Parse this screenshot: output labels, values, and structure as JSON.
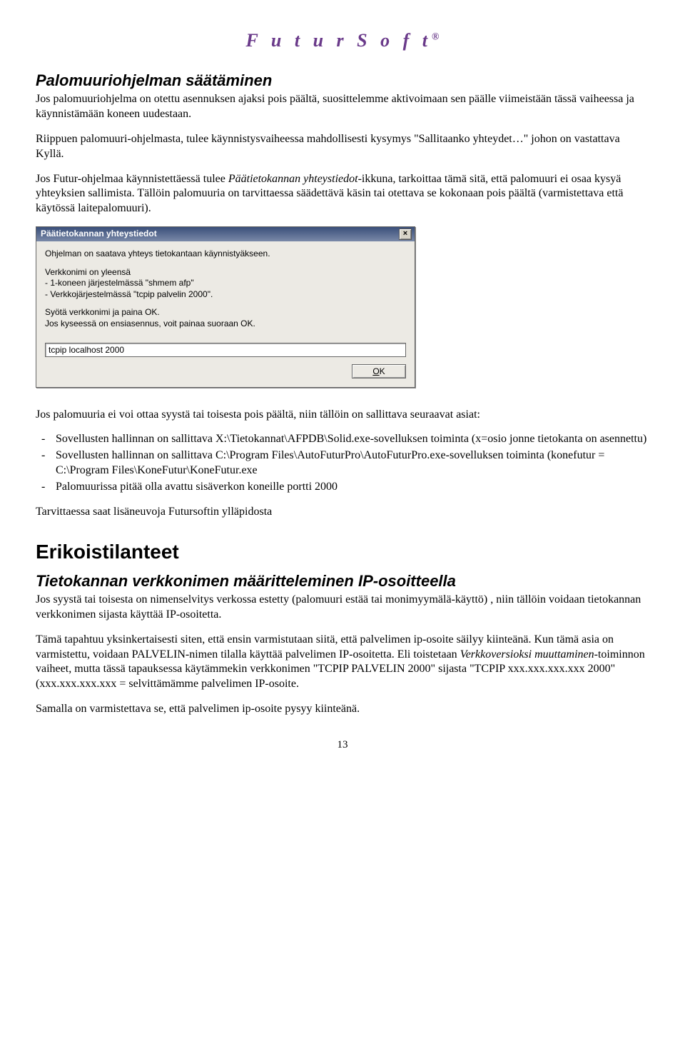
{
  "logo": "F u t u r S o f t",
  "logo_mark": "®",
  "section1": {
    "title": "Palomuuriohjelman säätäminen",
    "p1": "Jos palomuuriohjelma on otettu asennuksen ajaksi pois päältä, suosittelemme aktivoimaan sen päälle viimeistään tässä vaiheessa ja käynnistämään koneen uudestaan.",
    "p2": "Riippuen palomuuri-ohjelmasta, tulee käynnistysvaiheessa mahdollisesti kysymys \"Sallitaanko yhteydet…\" johon on vastattava Kyllä.",
    "p3a": "Jos Futur-ohjelmaa käynnistettäessä tulee ",
    "p3b": "Päätietokannan yhteystiedot",
    "p3c": "-ikkuna, tarkoittaa tämä sitä, että palomuuri ei osaa kysyä yhteyksien sallimista. Tällöin palomuuria on tarvittaessa säädettävä käsin tai otettava se kokonaan pois päältä (varmistettava että käytössä laitepalomuuri)."
  },
  "dialog": {
    "title": "Päätietokannan yhteystiedot",
    "line1": "Ohjelman on saatava yhteys tietokantaan käynnistyäkseen.",
    "line2": "Verkkonimi on yleensä",
    "line3": "- 1-koneen järjestelmässä \"shmem afp\"",
    "line4": "- Verkkojärjestelmässä \"tcpip palvelin 2000\".",
    "line5": "Syötä verkkonimi ja paina OK.",
    "line6": "Jos kyseessä on ensiasennus, voit painaa suoraan OK.",
    "input_value": "tcpip localhost 2000",
    "ok_label": "OK"
  },
  "section2": {
    "p1": "Jos palomuuria ei voi ottaa syystä tai toisesta pois päältä, niin tällöin on sallittava seuraavat asiat:",
    "bullets": [
      "Sovellusten hallinnan on sallittava X:\\Tietokannat\\AFPDB\\Solid.exe-sovelluksen toiminta (x=osio jonne tietokanta on asennettu)",
      "Sovellusten hallinnan on sallittava C:\\Program Files\\AutoFuturPro\\AutoFuturPro.exe-sovelluksen toiminta (konefutur = C:\\Program Files\\KoneFutur\\KoneFutur.exe",
      "Palomuurissa pitää olla avattu sisäverkon koneille portti 2000"
    ],
    "p2": "Tarvittaessa saat lisäneuvoja Futursoftin ylläpidosta"
  },
  "section3": {
    "title": "Erikoistilanteet",
    "subtitle": "Tietokannan verkkonimen määritteleminen IP-osoitteella",
    "p1": "Jos syystä tai toisesta on nimenselvitys verkossa estetty (palomuuri estää tai monimyymälä-käyttö) , niin tällöin voidaan tietokannan verkkonimen sijasta käyttää IP-osoitetta.",
    "p2a": "Tämä tapahtuu yksinkertaisesti siten, että ensin varmistutaan siitä, että palvelimen ip-osoite säilyy kiinteänä. Kun tämä asia on varmistettu, voidaan PALVELIN-nimen tilalla käyttää palvelimen IP-osoitetta. Eli toistetaan ",
    "p2b": "Verkkoversioksi muuttaminen",
    "p2c": "-toiminnon vaiheet, mutta tässä tapauksessa käytämmekin verkkonimen \"TCPIP PALVELIN 2000\" sijasta \"TCPIP xxx.xxx.xxx.xxx 2000\" (xxx.xxx.xxx.xxx = selvittämämme palvelimen IP-osoite.",
    "p3": "Samalla on varmistettava se, että palvelimen ip-osoite pysyy kiinteänä."
  },
  "page_number": "13"
}
